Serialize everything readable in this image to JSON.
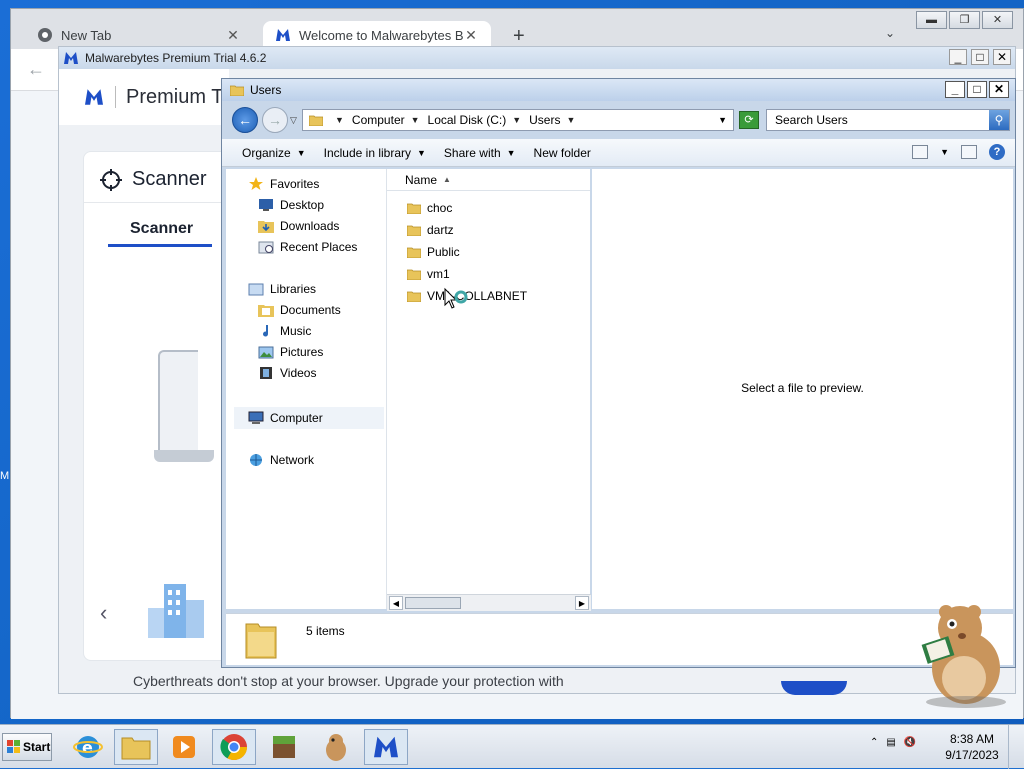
{
  "browser": {
    "tabs": [
      {
        "label": "New Tab",
        "icon": "chrome-icon"
      },
      {
        "label": "Welcome to Malwarebytes Browser",
        "icon": "malwarebytes-icon"
      }
    ]
  },
  "malwarebytes": {
    "window_title": "Malwarebytes Premium Trial  4.6.2",
    "header_product": "Premium T",
    "card_title": "Scanner",
    "tab_label": "Scanner",
    "footer_text": "Cyberthreats don't stop at your browser. Upgrade your protection with"
  },
  "explorer": {
    "title": "Users",
    "breadcrumb": [
      "Computer",
      "Local Disk (C:)",
      "Users"
    ],
    "search_placeholder": "Search Users",
    "commands": [
      "Organize",
      "Include in library",
      "Share with",
      "New folder"
    ],
    "nav": {
      "favorites_label": "Favorites",
      "favorites": [
        "Desktop",
        "Downloads",
        "Recent Places"
      ],
      "libraries_label": "Libraries",
      "libraries": [
        "Documents",
        "Music",
        "Pictures",
        "Videos"
      ],
      "computer_label": "Computer",
      "network_label": "Network"
    },
    "column_header": "Name",
    "files": [
      "choc",
      "dartz",
      "Public",
      "vm1",
      "VM1-COLLABNET"
    ],
    "preview_text": "Select a file to preview.",
    "item_count": "5 items"
  },
  "taskbar": {
    "start_label": "Start",
    "time": "8:38 AM",
    "date": "9/17/2023"
  },
  "desktop": {
    "edge_letter": "M"
  },
  "colors": {
    "desktop_bg": "#1466c8",
    "malwarebytes_blue": "#1e4fc7",
    "explorer_frame": "#c8d7e9",
    "folder_yellow": "#e8c45a"
  }
}
